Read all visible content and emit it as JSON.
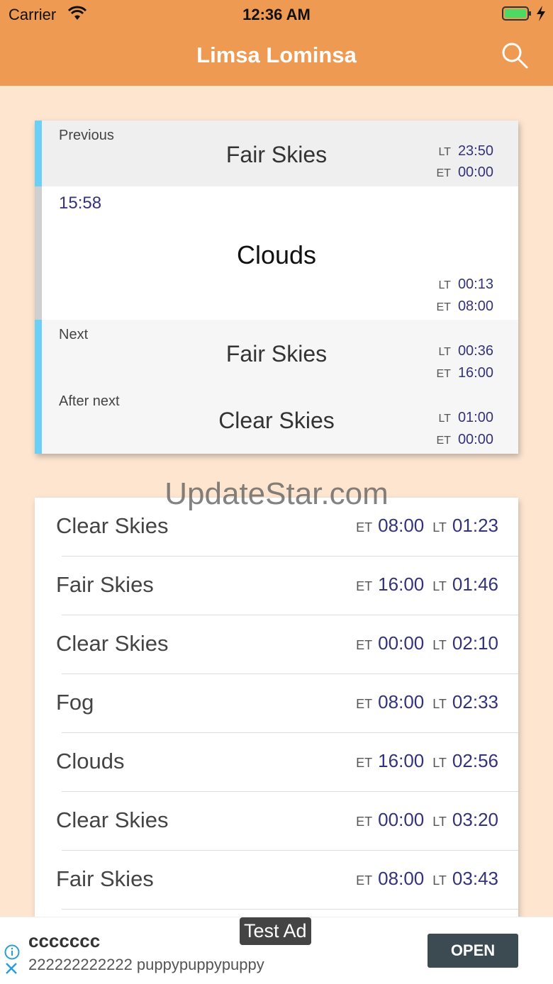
{
  "status": {
    "carrier": "Carrier",
    "time": "12:36 AM"
  },
  "nav": {
    "title": "Limsa Lominsa"
  },
  "forecast": {
    "previous": {
      "label": "Previous",
      "weather": "Fair Skies",
      "lt_label": "LT",
      "lt": "23:50",
      "et_label": "ET",
      "et": "00:00"
    },
    "current": {
      "countdown": "15:58",
      "weather": "Clouds",
      "lt_label": "LT",
      "lt": "00:13",
      "et_label": "ET",
      "et": "08:00"
    },
    "next": {
      "label": "Next",
      "weather": "Fair Skies",
      "lt_label": "LT",
      "lt": "00:36",
      "et_label": "ET",
      "et": "16:00"
    },
    "after_next": {
      "label": "After next",
      "weather": "Clear Skies",
      "lt_label": "LT",
      "lt": "01:00",
      "et_label": "ET",
      "et": "00:00"
    }
  },
  "watermark": "UpdateStar.com",
  "list": [
    {
      "weather": "Clear Skies",
      "et_label": "ET",
      "et": "08:00",
      "lt_label": "LT",
      "lt": "01:23"
    },
    {
      "weather": "Fair Skies",
      "et_label": "ET",
      "et": "16:00",
      "lt_label": "LT",
      "lt": "01:46"
    },
    {
      "weather": "Clear Skies",
      "et_label": "ET",
      "et": "00:00",
      "lt_label": "LT",
      "lt": "02:10"
    },
    {
      "weather": "Fog",
      "et_label": "ET",
      "et": "08:00",
      "lt_label": "LT",
      "lt": "02:33"
    },
    {
      "weather": "Clouds",
      "et_label": "ET",
      "et": "16:00",
      "lt_label": "LT",
      "lt": "02:56"
    },
    {
      "weather": "Clear Skies",
      "et_label": "ET",
      "et": "00:00",
      "lt_label": "LT",
      "lt": "03:20"
    },
    {
      "weather": "Fair Skies",
      "et_label": "ET",
      "et": "08:00",
      "lt_label": "LT",
      "lt": "03:43"
    }
  ],
  "ad": {
    "badge": "Test Ad",
    "title": "ccccccc",
    "subtitle": "222222222222 puppypuppypuppy",
    "cta": "OPEN"
  },
  "colors": {
    "nav": "#ee9a52",
    "background": "#fde5d0",
    "accent_bar": "#6ccff6",
    "time_text": "#33337a"
  }
}
